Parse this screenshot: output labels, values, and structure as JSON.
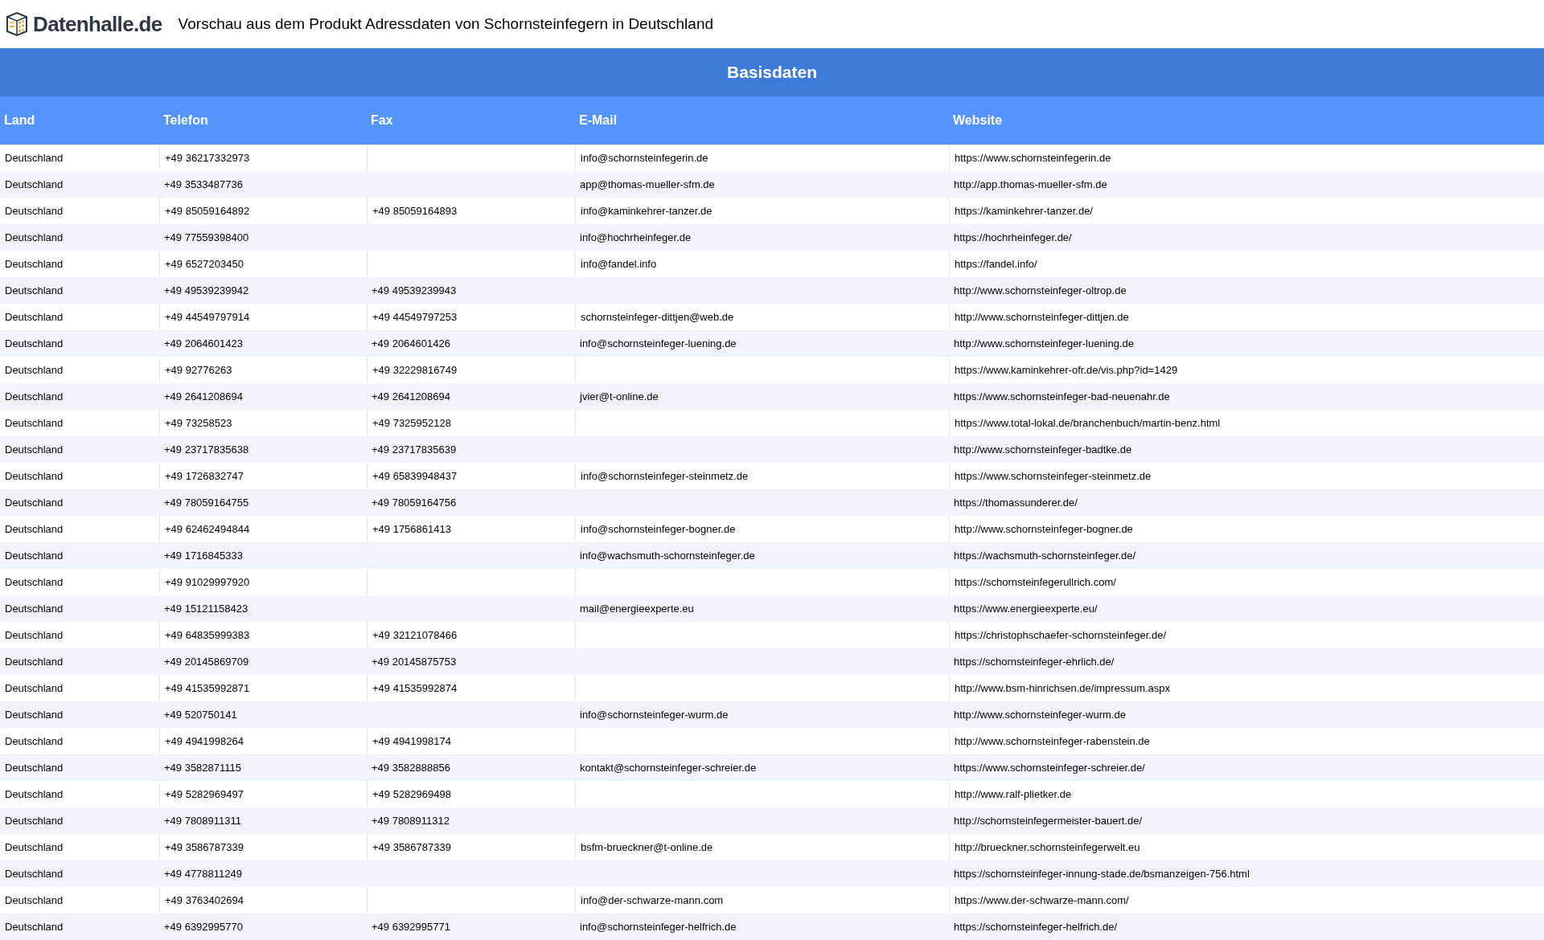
{
  "header": {
    "logo_text": "Datenhalle.de",
    "title": "Vorschau aus dem Produkt Adressdaten von Schornsteinfegern in Deutschland"
  },
  "table": {
    "group_title": "Basisdaten",
    "columns": [
      "Land",
      "Telefon",
      "Fax",
      "E-Mail",
      "Website"
    ],
    "rows": [
      {
        "land": "Deutschland",
        "telefon": "+49 36217332973",
        "email": "info@schornsteinfegerin.de",
        "website": "https://www.schornsteinfegerin.de"
      },
      {
        "land": "Deutschland",
        "telefon": "+49 3533487736",
        "email": "app@thomas-mueller-sfm.de",
        "website": "http://app.thomas-mueller-sfm.de"
      },
      {
        "land": "Deutschland",
        "telefon": "+49 85059164892",
        "fax": "+49 85059164893",
        "email": "info@kaminkehrer-tanzer.de",
        "website": "https://kaminkehrer-tanzer.de/"
      },
      {
        "land": "Deutschland",
        "telefon": "+49 77559398400",
        "email": "info@hochrheinfeger.de",
        "website": "https://hochrheinfeger.de/"
      },
      {
        "land": "Deutschland",
        "telefon": "+49 6527203450",
        "email": "info@fandel.info",
        "website": "https://fandel.info/"
      },
      {
        "land": "Deutschland",
        "telefon": "+49 49539239942",
        "fax": "+49 49539239943",
        "website": "http://www.schornsteinfeger-oltrop.de"
      },
      {
        "land": "Deutschland",
        "telefon": "+49 44549797914",
        "fax": "+49 44549797253",
        "email": "schornsteinfeger-dittjen@web.de",
        "website": "http://www.schornsteinfeger-dittjen.de"
      },
      {
        "land": "Deutschland",
        "telefon": "+49 2064601423",
        "fax": "+49 2064601426",
        "email": "info@schornsteinfeger-luening.de",
        "website": "http://www.schornsteinfeger-luening.de"
      },
      {
        "land": "Deutschland",
        "telefon": "+49 92776263",
        "fax": "+49 32229816749",
        "website": "https://www.kaminkehrer-ofr.de/vis.php?id=1429"
      },
      {
        "land": "Deutschland",
        "telefon": "+49 2641208694",
        "fax": "+49 2641208694",
        "email": "jvier@t-online.de",
        "website": "https://www.schornsteinfeger-bad-neuenahr.de"
      },
      {
        "land": "Deutschland",
        "telefon": "+49 73258523",
        "fax": "+49 7325952128",
        "website": "https://www.total-lokal.de/branchenbuch/martin-benz.html"
      },
      {
        "land": "Deutschland",
        "telefon": "+49 23717835638",
        "fax": "+49 23717835639",
        "website": "http://www.schornsteinfeger-badtke.de"
      },
      {
        "land": "Deutschland",
        "telefon": "+49 1726832747",
        "fax": "+49 65839948437",
        "email": "info@schornsteinfeger-steinmetz.de",
        "website": "https://www.schornsteinfeger-steinmetz.de"
      },
      {
        "land": "Deutschland",
        "telefon": "+49 78059164755",
        "fax": "+49 78059164756",
        "website": "https://thomassunderer.de/"
      },
      {
        "land": "Deutschland",
        "telefon": "+49 62462494844",
        "fax": "+49 1756861413",
        "email": "info@schornsteinfeger-bogner.de",
        "website": "http://www.schornsteinfeger-bogner.de"
      },
      {
        "land": "Deutschland",
        "telefon": "+49 1716845333",
        "email": "info@wachsmuth-schornsteinfeger.de",
        "website": "https://wachsmuth-schornsteinfeger.de/"
      },
      {
        "land": "Deutschland",
        "telefon": "+49 91029997920",
        "website": "https://schornsteinfegerullrich.com/"
      },
      {
        "land": "Deutschland",
        "telefon": "+49 15121158423",
        "email": "mail@energieexperte.eu",
        "website": "https://www.energieexperte.eu/"
      },
      {
        "land": "Deutschland",
        "telefon": "+49 64835999383",
        "fax": "+49 32121078466",
        "website": "https://christophschaefer-schornsteinfeger.de/"
      },
      {
        "land": "Deutschland",
        "telefon": "+49 20145869709",
        "fax": "+49 20145875753",
        "website": "https://schornsteinfeger-ehrlich.de/"
      },
      {
        "land": "Deutschland",
        "telefon": "+49 41535992871",
        "fax": "+49 41535992874",
        "website": "http://www.bsm-hinrichsen.de/impressum.aspx"
      },
      {
        "land": "Deutschland",
        "telefon": "+49 520750141",
        "email": "info@schornsteinfeger-wurm.de",
        "website": "http://www.schornsteinfeger-wurm.de"
      },
      {
        "land": "Deutschland",
        "telefon": "+49 4941998264",
        "fax": "+49 4941998174",
        "website": "http://www.schornsteinfeger-rabenstein.de"
      },
      {
        "land": "Deutschland",
        "telefon": "+49 3582871115",
        "fax": "+49 3582888856",
        "email": "kontakt@schornsteinfeger-schreier.de",
        "website": "https://www.schornsteinfeger-schreier.de/"
      },
      {
        "land": "Deutschland",
        "telefon": "+49 5282969497",
        "fax": "+49 5282969498",
        "website": "http://www.ralf-plietker.de"
      },
      {
        "land": "Deutschland",
        "telefon": "+49 7808911311",
        "fax": "+49 7808911312",
        "website": "http://schornsteinfegermeister-bauert.de/"
      },
      {
        "land": "Deutschland",
        "telefon": "+49 3586787339",
        "fax": "+49 3586787339",
        "email": "bsfm-brueckner@t-online.de",
        "website": "http://brueckner.schornsteinfegerwelt.eu"
      },
      {
        "land": "Deutschland",
        "telefon": "+49 4778811249",
        "website": "https://schornsteinfeger-innung-stade.de/bsmanzeigen-756.html"
      },
      {
        "land": "Deutschland",
        "telefon": "+49 3763402694",
        "email": "info@der-schwarze-mann.com",
        "website": "https://www.der-schwarze-mann.com/"
      },
      {
        "land": "Deutschland",
        "telefon": "+49 6392995770",
        "fax": "+49 6392995771",
        "email": "info@schornsteinfeger-helfrich.de",
        "website": "https://schornsteinfeger-helfrich.de/"
      }
    ]
  }
}
